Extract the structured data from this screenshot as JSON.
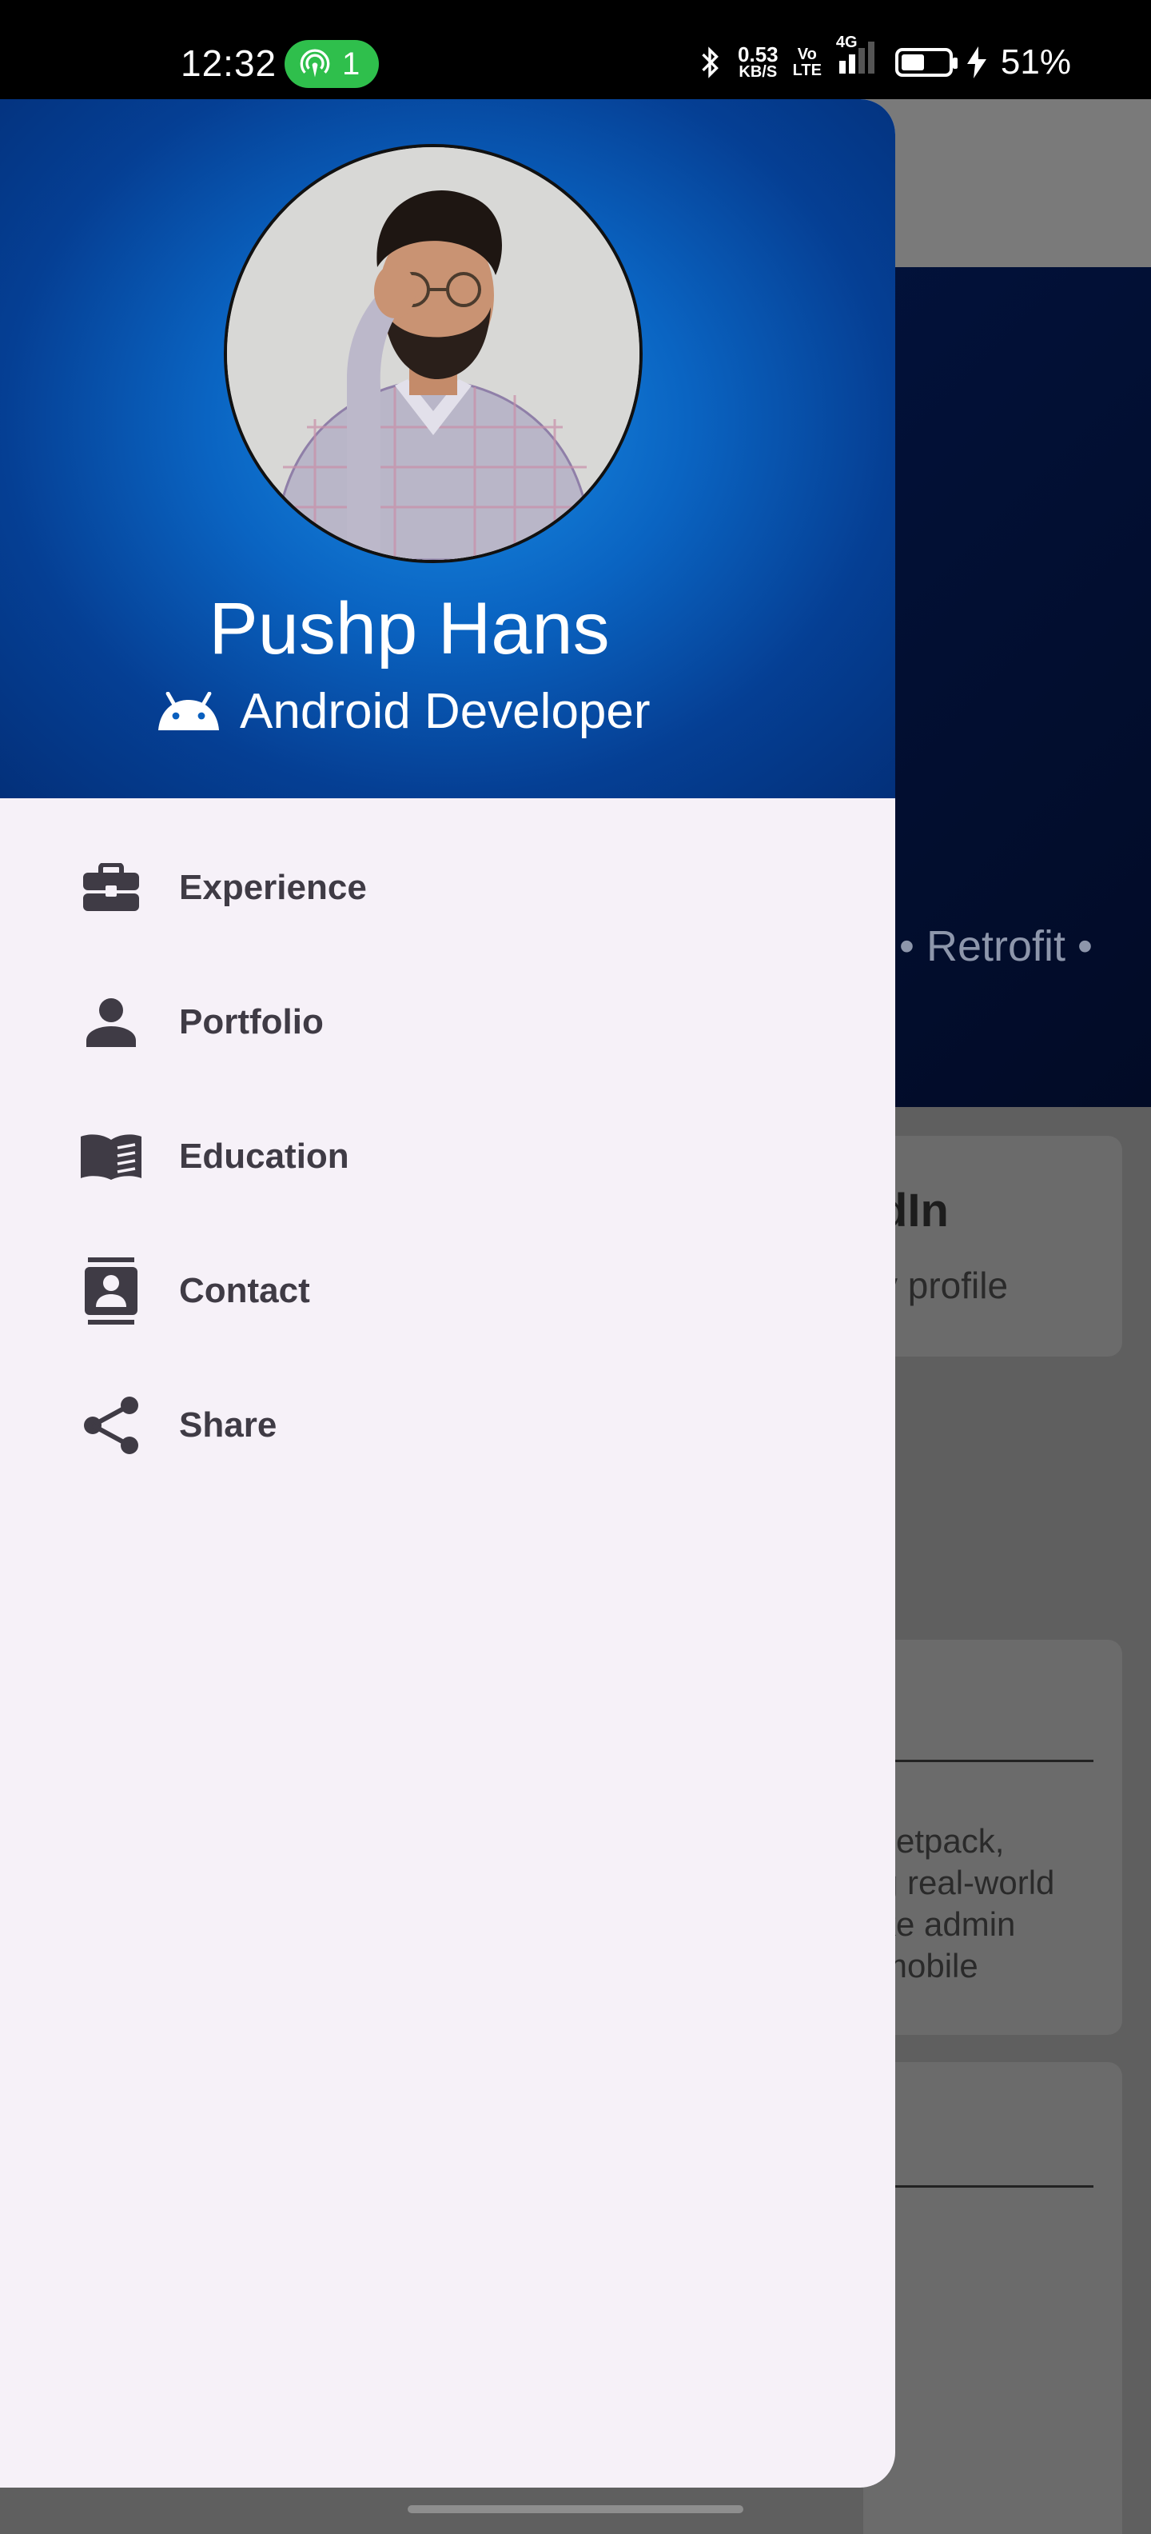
{
  "status_bar": {
    "time": "12:32",
    "hotspot_count": "1",
    "net_speed_value": "0.53",
    "net_speed_unit": "KB/S",
    "volte_top": "Vo",
    "volte_bottom": "LTE",
    "network": "4G",
    "battery_percent": "51%",
    "battery_level": 0.51
  },
  "drawer": {
    "profile_name": "Pushp Hans",
    "profile_role": "Android Developer",
    "menu": [
      {
        "label": "Experience",
        "icon": "briefcase-icon"
      },
      {
        "label": "Portfolio",
        "icon": "person-icon"
      },
      {
        "label": "Education",
        "icon": "book-icon"
      },
      {
        "label": "Contact",
        "icon": "contact-card-icon"
      },
      {
        "label": "Share",
        "icon": "share-icon"
      }
    ]
  },
  "background": {
    "skills_fragment": "e • Retrofit •",
    "card1_title": "dIn",
    "card1_sub": "y profile",
    "card2_text": "Jetpack,\ng real-world\nke admin\nmobile"
  },
  "colors": {
    "header_center": "#1a8ee6",
    "header_edge": "#03307a",
    "drawer_bg": "#f6f1f8",
    "icon_color": "#3f3b45",
    "hotspot_green": "#2fbf4c"
  }
}
